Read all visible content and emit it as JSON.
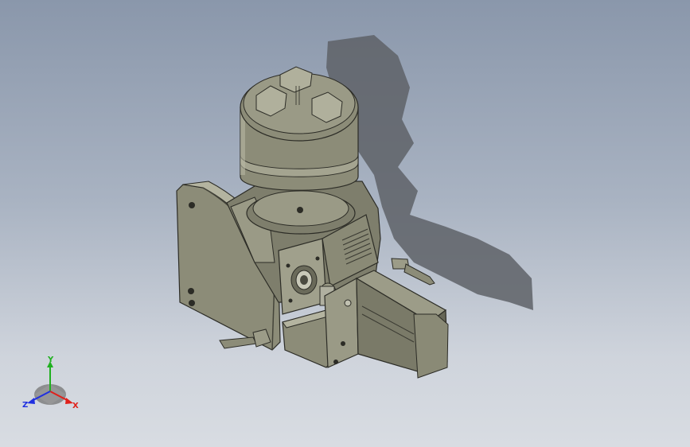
{
  "viewport": {
    "model": "rotary-table-with-3-jaw-chuck-and-servo-motor",
    "background_top": "#8a97ab",
    "background_bottom": "#d8dce2",
    "part_color": "#8c8c78",
    "part_dark": "#55554a",
    "part_light": "#b4b4a0"
  },
  "triad": {
    "x_label": "X",
    "y_label": "Y",
    "z_label": "Z",
    "x_color": "#e0201a",
    "y_color": "#20b020",
    "z_color": "#2030e0"
  }
}
